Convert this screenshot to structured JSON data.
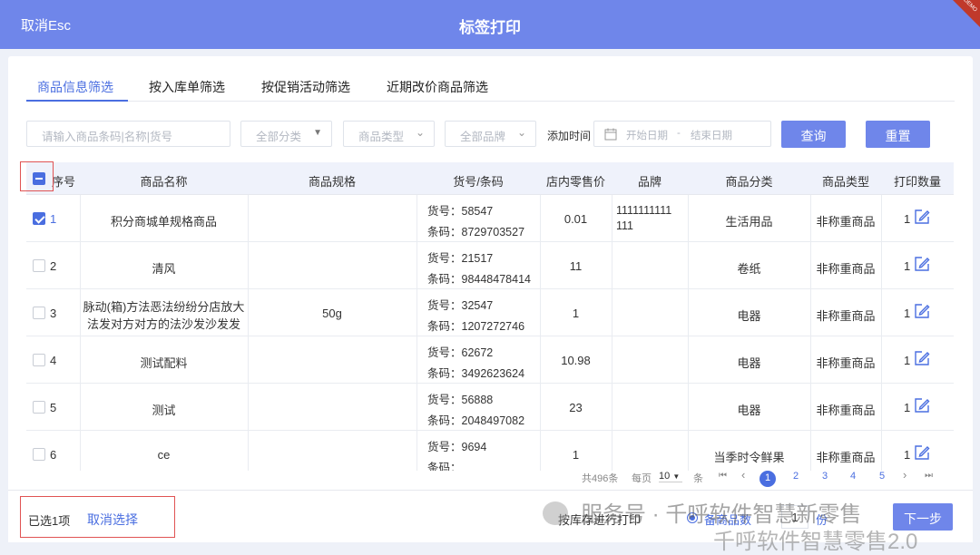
{
  "header": {
    "cancel_label": "取消Esc",
    "title": "标签打印",
    "ribbon": "DEMO"
  },
  "tabs": [
    {
      "label": "商品信息筛选",
      "active": true
    },
    {
      "label": "按入库单筛选",
      "active": false
    },
    {
      "label": "按促销活动筛选",
      "active": false
    },
    {
      "label": "近期改价商品筛选",
      "active": false
    }
  ],
  "filters": {
    "search_placeholder": "请输入商品条码|名称|货号",
    "category": "全部分类",
    "type": "商品类型",
    "brand": "全部品牌",
    "date_label": "添加时间",
    "start_date": "开始日期",
    "date_sep": "-",
    "end_date": "结束日期",
    "query_label": "查询",
    "reset_label": "重置"
  },
  "columns": [
    "序号",
    "商品名称",
    "商品规格",
    "货号/条码",
    "店内零售价",
    "品牌",
    "商品分类",
    "商品类型",
    "打印数量"
  ],
  "rows": [
    {
      "idx": "1",
      "checked": true,
      "name": "积分商城单规格商品",
      "name2": "",
      "spec": "",
      "sku": "货号：58547",
      "barcode": "条码：8729703527",
      "price": "0.01",
      "brand": "1111111111",
      "brand2": "111",
      "category": "生活用品",
      "ptype": "非称重商品",
      "qty": "1"
    },
    {
      "idx": "2",
      "checked": false,
      "name": "清风",
      "name2": "",
      "spec": "",
      "sku": "货号：21517",
      "barcode": "条码：98448478414",
      "price": "11",
      "brand": "",
      "brand2": "",
      "category": "卷纸",
      "ptype": "非称重商品",
      "qty": "1"
    },
    {
      "idx": "3",
      "checked": false,
      "name": "脉动(箱)方法恶法纷纷分店放大",
      "name2": "法发对方对方的法沙发沙发发",
      "spec": "50g",
      "sku": "货号：32547",
      "barcode": "条码：1207272746",
      "price": "1",
      "brand": "",
      "brand2": "",
      "category": "电器",
      "ptype": "非称重商品",
      "qty": "1"
    },
    {
      "idx": "4",
      "checked": false,
      "name": "测试配料",
      "name2": "",
      "spec": "",
      "sku": "货号：62672",
      "barcode": "条码：3492623624",
      "price": "10.98",
      "brand": "",
      "brand2": "",
      "category": "电器",
      "ptype": "非称重商品",
      "qty": "1"
    },
    {
      "idx": "5",
      "checked": false,
      "name": "测试",
      "name2": "",
      "spec": "",
      "sku": "货号：56888",
      "barcode": "条码：2048497082",
      "price": "23",
      "brand": "",
      "brand2": "",
      "category": "电器",
      "ptype": "非称重商品",
      "qty": "1"
    },
    {
      "idx": "6",
      "checked": false,
      "name": "ce",
      "name2": "",
      "spec": "",
      "sku": "货号：9694",
      "barcode": "条码：",
      "price": "1",
      "brand": "",
      "brand2": "",
      "category": "当季时令鲜果",
      "ptype": "非称重商品",
      "qty": "1"
    }
  ],
  "pager": {
    "total": "共496条",
    "per_page_label": "每页",
    "per_page": "10",
    "unit": "条",
    "first": "⏮",
    "prev": "‹",
    "pages": [
      "1",
      "2",
      "3",
      "4",
      "5"
    ],
    "next": "›",
    "last": "⏭"
  },
  "footer": {
    "selected_text": "已选1项",
    "cancel_select": "取消选择",
    "print_by_stock": "按库存进行打印",
    "option_label": "备商品数",
    "copies_value": "1",
    "copies_unit": "份",
    "next_label": "下一步"
  },
  "watermark": {
    "line1": "服务号 · 千呼软件智慧新零售",
    "line2": "千呼软件智慧零售2.0"
  },
  "colors": {
    "accent": "#6f86ea",
    "link": "#4a6ee0",
    "highlight": "#e05353"
  }
}
